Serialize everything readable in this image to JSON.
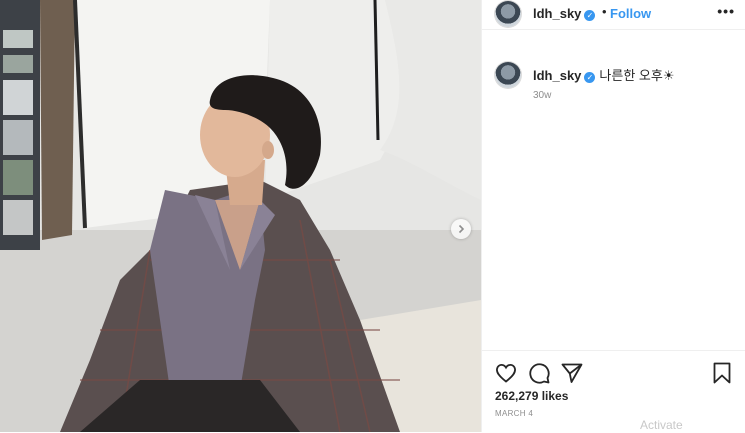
{
  "post": {
    "username": "ldh_sky",
    "verified_glyph": "✓",
    "follow_label": "Follow",
    "dot": "•",
    "more_label": "•••"
  },
  "caption": {
    "username": "ldh_sky",
    "text": "나른한 오후☀",
    "time": "30w"
  },
  "stats": {
    "likes": "262,279 likes",
    "date": "MARCH 4"
  },
  "icons": {
    "like": "heart-icon",
    "comment": "comment-icon",
    "share": "share-icon",
    "save": "bookmark-icon",
    "next": "chevron-right-icon"
  },
  "watermark": {
    "text": "Activate"
  },
  "colors": {
    "accent": "#3897f0",
    "muted": "#8e8e8e",
    "text": "#262626"
  }
}
